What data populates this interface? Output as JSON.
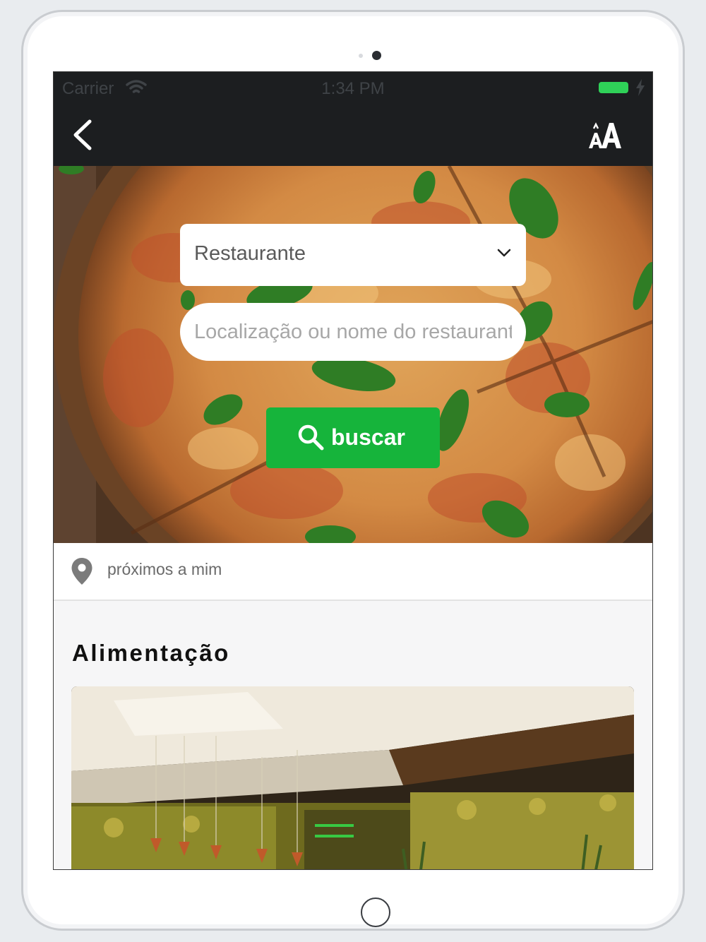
{
  "status_bar": {
    "carrier": "Carrier",
    "time": "1:34 PM",
    "wifi_icon": "wifi-icon",
    "battery_icon": "battery-icon",
    "charging_icon": "bolt-icon"
  },
  "nav": {
    "back_icon": "chevron-left-icon",
    "font_size_icon": "text-size-icon"
  },
  "search": {
    "category_value": "Restaurante",
    "category_icon": "chevron-down-icon",
    "location_placeholder": "Localização ou nome do restaurante",
    "location_value": "",
    "button_label": "buscar",
    "button_icon": "search-icon"
  },
  "nearby": {
    "label": "próximos a mim",
    "icon": "location-pin-icon"
  },
  "section": {
    "title": "Alimentação"
  },
  "colors": {
    "accent_green": "#16b43b",
    "nav_background": "#1c1e20",
    "battery": "#2fd158"
  }
}
